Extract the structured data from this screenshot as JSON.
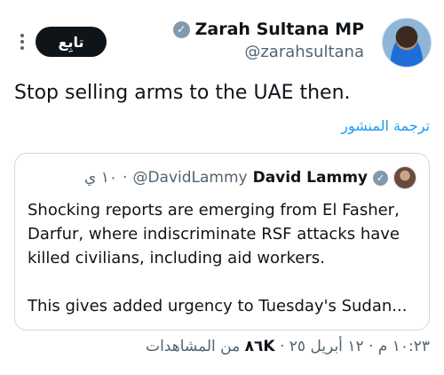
{
  "header": {
    "follow_label": "تابِع",
    "author_name": "Zarah Sultana MP",
    "author_handle": "@zarahsultana",
    "verified_mark": "✓"
  },
  "tweet": {
    "text": "Stop selling arms to the UAE then.",
    "translate_label": "ترجمة المنشور"
  },
  "quote": {
    "name": "David Lammy",
    "handle": "@DavidLammy",
    "time": "١٠ ي",
    "separator": "·",
    "paragraph1": "Shocking reports are emerging from El Fasher, Darfur, where indiscriminate RSF attacks have killed civilians, including aid workers.",
    "paragraph2": "This gives added urgency to Tuesday's Sudan..."
  },
  "meta": {
    "time": "١٠:٢٣ م",
    "separator1": "·",
    "date": "١٢ أبريل ٢٥",
    "separator2": "·",
    "views_count": "٨٦K",
    "views_label": "من المشاهدات"
  },
  "colors": {
    "accent": "#1d9bf0",
    "text": "#0f1419",
    "muted": "#536471",
    "border": "#cfd9de"
  }
}
